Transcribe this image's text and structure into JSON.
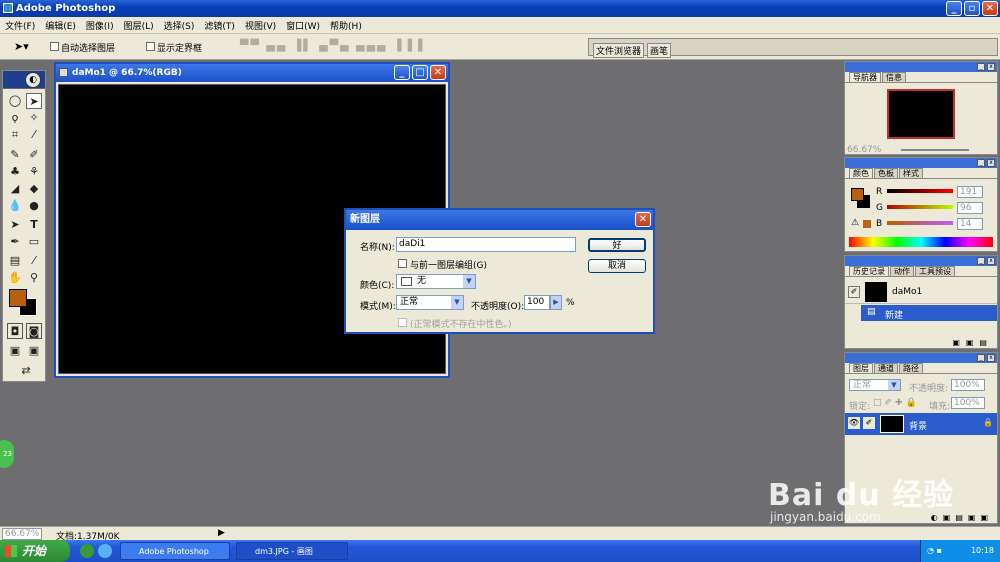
{
  "app": {
    "title": "Adobe Photoshop"
  },
  "menu": [
    "文件(F)",
    "编辑(E)",
    "图像(I)",
    "图层(L)",
    "选择(S)",
    "滤镜(T)",
    "视图(V)",
    "窗口(W)",
    "帮助(H)"
  ],
  "options": {
    "auto_select": "自动选择图层",
    "show_bounds": "显示定界框",
    "tab_browser": "文件浏览器",
    "tab_brush": "画笔"
  },
  "document": {
    "title": "daMo1 @ 66.7%(RGB)"
  },
  "dialog": {
    "title": "新图层",
    "name_label": "名称(N):",
    "name_value": "daDi1",
    "group_label": "与前一图层编组(G)",
    "color_label": "颜色(C):",
    "color_value": "无",
    "mode_label": "模式(M):",
    "mode_value": "正常",
    "opacity_label": "不透明度(O):",
    "opacity_value": "100",
    "percent": "%",
    "neutral_label": "(正常模式不存在中性色。)",
    "ok": "好",
    "cancel": "取消"
  },
  "navigator": {
    "tab_nav": "导航器",
    "tab_info": "信息",
    "zoom": "66.67%"
  },
  "color": {
    "tab_color": "颜色",
    "tab_swatch": "色板",
    "tab_style": "样式",
    "r_label": "R",
    "g_label": "G",
    "b_label": "B",
    "r": "191",
    "g": "96",
    "b": "14",
    "fg": "#b8600e"
  },
  "history": {
    "tab_history": "历史记录",
    "tab_actions": "动作",
    "tab_presets": "工具预设",
    "snapshot": "daMo1",
    "step": "新建"
  },
  "layers": {
    "tab_layers": "图层",
    "tab_channels": "通道",
    "tab_paths": "路径",
    "mode": "正常",
    "opacity_label": "不透明度:",
    "opacity": "100%",
    "lock_label": "锁定:",
    "fill_label": "填充:",
    "fill": "100%",
    "layer_name": "背景"
  },
  "status": {
    "zoom": "66.67%",
    "doc": "文档:1.37M/0K"
  },
  "taskbar": {
    "start": "开始",
    "task1": "Adobe Photoshop",
    "task2": "dm3.JPG - 画图",
    "clock": "10:18"
  },
  "badge": {
    "num": "23"
  },
  "watermark": {
    "brand": "Bai du 经验",
    "url": "jingyan.baidu.com"
  }
}
